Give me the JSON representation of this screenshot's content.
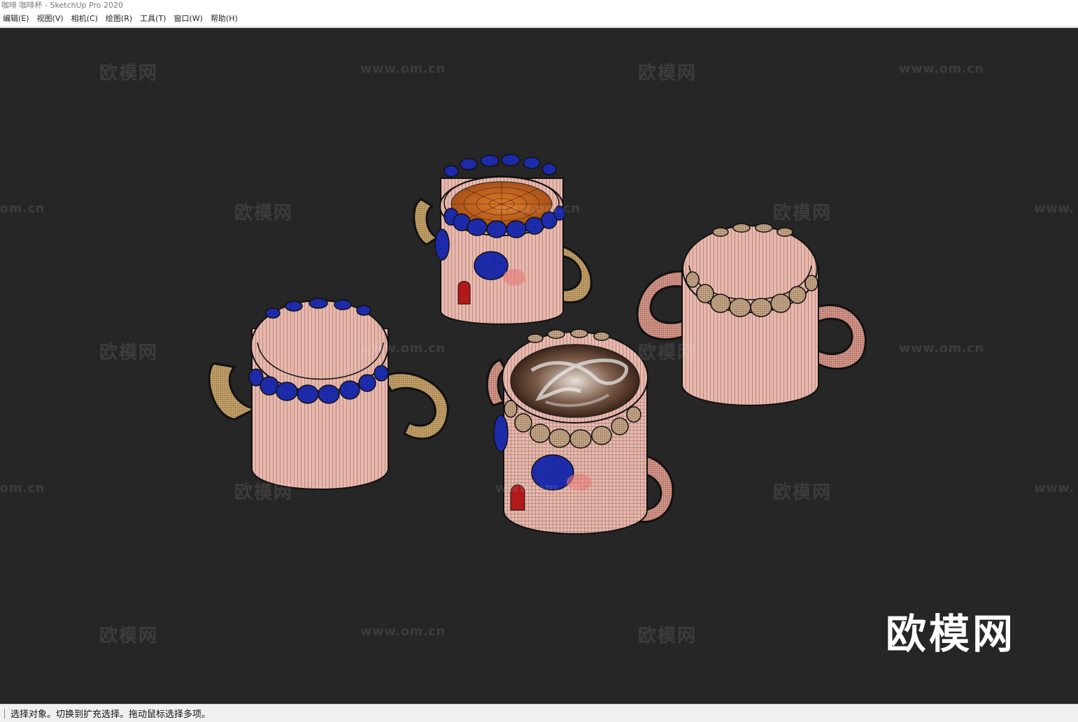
{
  "window": {
    "title": "咖啡 咖啡杯 - SketchUp Pro 2020"
  },
  "menubar": {
    "items": [
      {
        "label": "编辑(E)"
      },
      {
        "label": "视图(V)"
      },
      {
        "label": "相机(C)"
      },
      {
        "label": "绘图(R)"
      },
      {
        "label": "工具(T)"
      },
      {
        "label": "窗口(W)"
      },
      {
        "label": "帮助(H)"
      }
    ]
  },
  "viewport": {
    "background": "#262626",
    "watermark_logo": "欧模网",
    "watermark_url": "www.om.cn",
    "watermark_url_left": "om.cn",
    "watermark_url_right": "www.",
    "brand_logo": "欧模网",
    "mug_colors": {
      "body": "#e9b7ac",
      "blue_bead": "#1f2fb8",
      "gold": "#c8a46a",
      "pink_handle": "#d99a8c",
      "coffee": "#c2621e",
      "red_spot": "#b01a1a"
    }
  },
  "statusbar": {
    "text": "选择对象。切换到扩充选择。拖动鼠标选择多项。"
  }
}
